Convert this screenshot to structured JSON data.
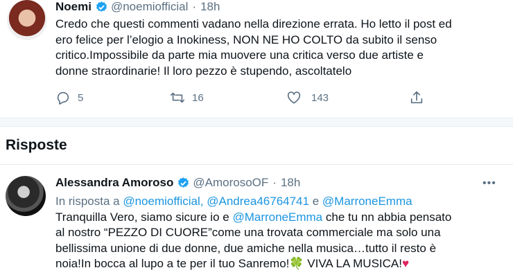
{
  "tweet": {
    "author_name": "Noemi",
    "handle": "@noemiofficial",
    "separator": "·",
    "time": "18h",
    "text_lines": [
      "Credo che questi commenti vadano nella direzione errata. Ho letto il post ed",
      "ero felice per l’elogio a Inokiness, NON NE HO COLTO da subito il senso",
      "critico.Impossibile da parte mia muovere una critica verso due artiste e",
      "donne straordinarie! Il loro pezzo è stupendo, ascoltatelo"
    ],
    "reply_count": "5",
    "retweet_count": "16",
    "like_count": "143"
  },
  "replies_section": {
    "title": "Risposte"
  },
  "reply": {
    "author_name": "Alessandra Amoroso",
    "handle": "@AmorosoOF",
    "separator": "·",
    "time": "18h",
    "in_reply_prefix": "In risposta a",
    "mention_1": "@noemiofficial,",
    "mention_2": "@Andrea46764741",
    "and_word": "e",
    "mention_3": "@MarroneEmma",
    "line1_a": "Tranquilla Vero, siamo sicure io e",
    "line1_mention": "@MarroneEmma",
    "line1_b": "che tu nn abbia pensato",
    "line2": "al nostro “PEZZO DI CUORE”come una trovata commerciale ma solo una",
    "line3": "bellissima unione di due donne, due amiche nella musica…tutto il resto è",
    "line4_a": "noia!In bocca al lupo a te per il tuo Sanremo!",
    "clover": "🍀",
    "line4_b": "VIVA LA MUSICA!",
    "heart": "♥"
  },
  "colors": {
    "link": "#1b95e0",
    "muted": "#5b7083",
    "verified": "#1da1f2",
    "heart": "#e0245e"
  },
  "icons": [
    "verified-badge-icon",
    "more-options-icon",
    "reply-icon",
    "retweet-icon",
    "like-icon",
    "share-icon",
    "clover-emoji",
    "heart-emoji"
  ]
}
